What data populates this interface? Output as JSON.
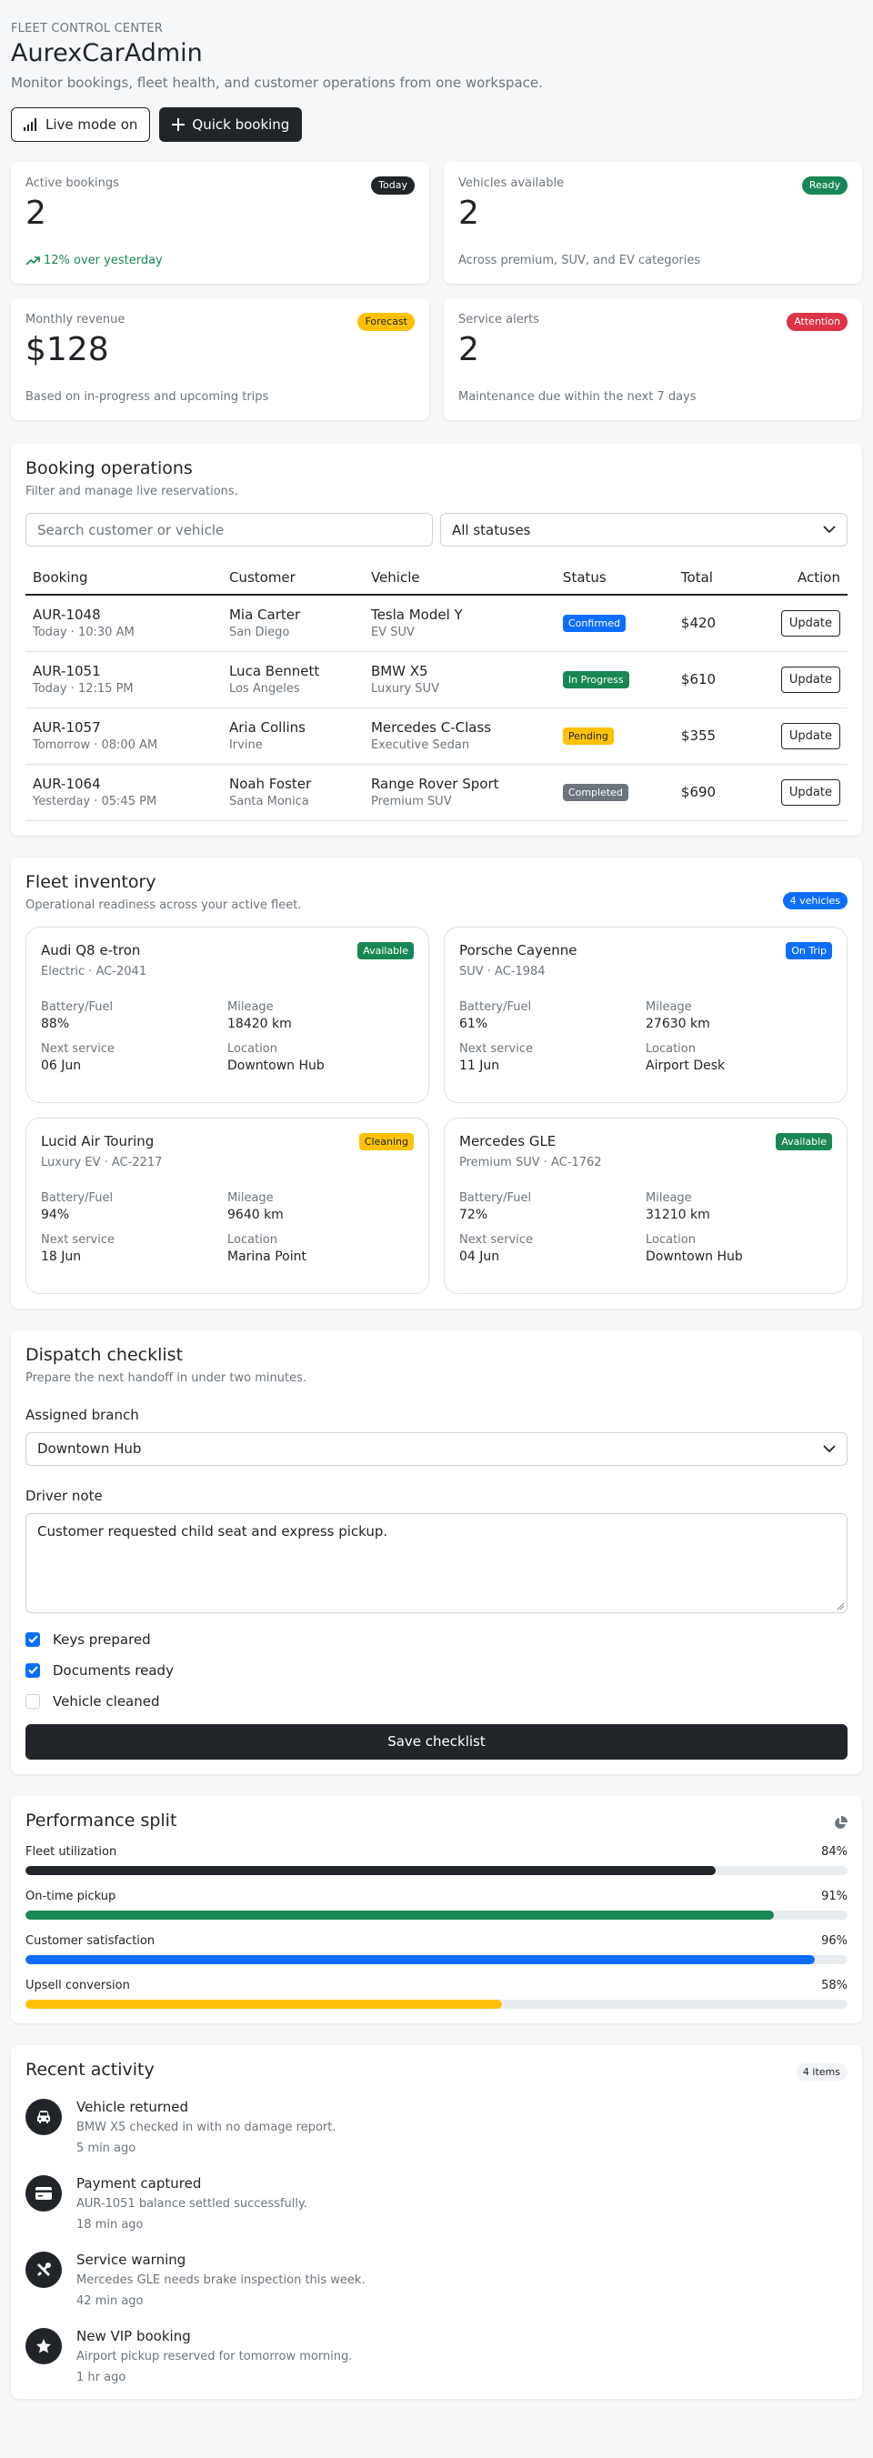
{
  "header": {
    "eyebrow": "FLEET CONTROL CENTER",
    "title": "AurexCarAdmin",
    "subtitle": "Monitor bookings, fleet health, and customer operations from one workspace.",
    "live_mode_label": "Live mode on",
    "quick_booking_label": "Quick booking"
  },
  "stats": [
    {
      "label": "Active bookings",
      "value": "2",
      "badge": "Today",
      "note": "12% over yesterday"
    },
    {
      "label": "Vehicles available",
      "value": "2",
      "badge": "Ready",
      "note": "Across premium, SUV, and EV categories"
    },
    {
      "label": "Monthly revenue",
      "value": "$128",
      "badge": "Forecast",
      "note": "Based on in-progress and upcoming trips"
    },
    {
      "label": "Service alerts",
      "value": "2",
      "badge": "Attention",
      "note": "Maintenance due within the next 7 days"
    }
  ],
  "bookings": {
    "title": "Booking operations",
    "subtitle": "Filter and manage live reservations.",
    "search_placeholder": "Search customer or vehicle",
    "status_filter": "All statuses",
    "columns": [
      "Booking",
      "Customer",
      "Vehicle",
      "Status",
      "Total",
      "Action"
    ],
    "rows": [
      {
        "id": "AUR-1048",
        "when": "Today · 10:30 AM",
        "customer": "Mia Carter",
        "city": "San Diego",
        "vehicle": "Tesla Model Y",
        "vtype": "EV SUV",
        "status": "Confirmed",
        "total": "$420",
        "action": "Update"
      },
      {
        "id": "AUR-1051",
        "when": "Today · 12:15 PM",
        "customer": "Luca Bennett",
        "city": "Los Angeles",
        "vehicle": "BMW X5",
        "vtype": "Luxury SUV",
        "status": "In Progress",
        "total": "$610",
        "action": "Update"
      },
      {
        "id": "AUR-1057",
        "when": "Tomorrow · 08:00 AM",
        "customer": "Aria Collins",
        "city": "Irvine",
        "vehicle": "Mercedes C-Class",
        "vtype": "Executive Sedan",
        "status": "Pending",
        "total": "$355",
        "action": "Update"
      },
      {
        "id": "AUR-1064",
        "when": "Yesterday · 05:45 PM",
        "customer": "Noah Foster",
        "city": "Santa Monica",
        "vehicle": "Range Rover Sport",
        "vtype": "Premium SUV",
        "status": "Completed",
        "total": "$690",
        "action": "Update"
      }
    ]
  },
  "fleet": {
    "title": "Fleet inventory",
    "subtitle": "Operational readiness across your active fleet.",
    "count_badge": "4 vehicles",
    "labels": {
      "battery": "Battery/Fuel",
      "mileage": "Mileage",
      "service": "Next service",
      "location": "Location"
    },
    "vehicles": [
      {
        "name": "Audi Q8 e-tron",
        "meta": "Electric · AC-2041",
        "badge": "Available",
        "battery": "88%",
        "mileage": "18420 km",
        "service": "06 Jun",
        "location": "Downtown Hub"
      },
      {
        "name": "Porsche Cayenne",
        "meta": "SUV · AC-1984",
        "badge": "On Trip",
        "battery": "61%",
        "mileage": "27630 km",
        "service": "11 Jun",
        "location": "Airport Desk"
      },
      {
        "name": "Lucid Air Touring",
        "meta": "Luxury EV · AC-2217",
        "badge": "Cleaning",
        "battery": "94%",
        "mileage": "9640 km",
        "service": "18 Jun",
        "location": "Marina Point"
      },
      {
        "name": "Mercedes GLE",
        "meta": "Premium SUV · AC-1762",
        "badge": "Available",
        "battery": "72%",
        "mileage": "31210 km",
        "service": "04 Jun",
        "location": "Downtown Hub"
      }
    ]
  },
  "checklist": {
    "title": "Dispatch checklist",
    "subtitle": "Prepare the next handoff in under two minutes.",
    "branch_label": "Assigned branch",
    "branch_value": "Downtown Hub",
    "note_label": "Driver note",
    "note_value": "Customer requested child seat and express pickup.",
    "items": [
      {
        "label": "Keys prepared",
        "checked": true
      },
      {
        "label": "Documents ready",
        "checked": true
      },
      {
        "label": "Vehicle cleaned",
        "checked": false
      }
    ],
    "save_label": "Save checklist"
  },
  "performance": {
    "title": "Performance split",
    "metrics": [
      {
        "label": "Fleet utilization",
        "value": "84%",
        "pct": 84,
        "color": "#212529"
      },
      {
        "label": "On-time pickup",
        "value": "91%",
        "pct": 91,
        "color": "#198754"
      },
      {
        "label": "Customer satisfaction",
        "value": "96%",
        "pct": 96,
        "color": "#0d6efd"
      },
      {
        "label": "Upsell conversion",
        "value": "58%",
        "pct": 58,
        "color": "#ffc107"
      }
    ]
  },
  "activity": {
    "title": "Recent activity",
    "count_badge": "4 items",
    "items": [
      {
        "icon": "car-icon",
        "title": "Vehicle returned",
        "desc": "BMW X5 checked in with no damage report.",
        "time": "5 min ago"
      },
      {
        "icon": "credit-card-icon",
        "title": "Payment captured",
        "desc": "AUR-1051 balance settled successfully.",
        "time": "18 min ago"
      },
      {
        "icon": "tools-icon",
        "title": "Service warning",
        "desc": "Mercedes GLE needs brake inspection this week.",
        "time": "42 min ago"
      },
      {
        "icon": "star-icon",
        "title": "New VIP booking",
        "desc": "Airport pickup reserved for tomorrow morning.",
        "time": "1 hr ago"
      }
    ]
  },
  "colors": {
    "dark": "#212529",
    "green": "#198754",
    "blue": "#0d6efd",
    "yellow": "#ffc107",
    "red": "#dc3545",
    "gray": "#6c757d"
  }
}
